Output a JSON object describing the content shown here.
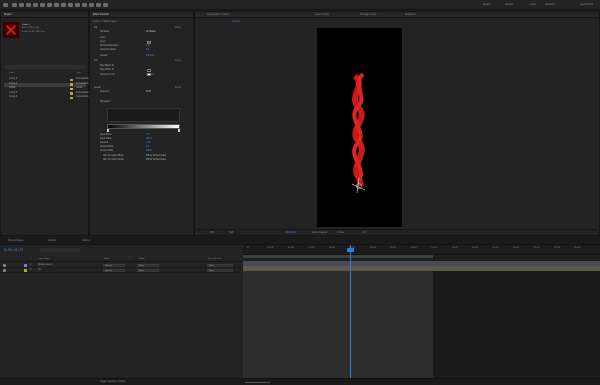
{
  "top_toolbar": {
    "workspaces": [
      "Default",
      "Review",
      "Learn",
      "Standard",
      "Small Screen",
      "Libraries"
    ],
    "search_help": "Search Help"
  },
  "project_panel": {
    "tab": "Project",
    "comp_name": "Comp 1",
    "info_line1": "800 x 1200 (1.00)",
    "info_line2": "Δ 0;00;10;00, 29.97 fps",
    "columns": [
      "Name",
      "Type"
    ],
    "items": [
      {
        "name": "Comp 1",
        "type": "Composition",
        "color": "#b5a14d"
      },
      {
        "name": "Comp 1",
        "type": "Composition",
        "color": "#b5a14d"
      },
      {
        "name": "Solids",
        "type": "Folder",
        "color": "#c9b24b"
      },
      {
        "name": "Comp 2",
        "type": "Composition",
        "color": "#b5a14d"
      },
      {
        "name": "Comp 3",
        "type": "Composition",
        "color": "#b5a14d"
      }
    ]
  },
  "effect_controls": {
    "tab": "Effect Controls",
    "subtitle": "Comp 1 • Shape Layer 1",
    "effects": [
      {
        "label": "Fill",
        "value": "Reset"
      },
      {
        "label": "Fill Mask",
        "value": "All Masks"
      },
      {
        "label": "Color",
        "value": ""
      },
      {
        "label": "Invert",
        "value": ""
      },
      {
        "label": "Horizontal Feather",
        "value": "0.0"
      },
      {
        "label": "Vertical Feather",
        "value": "0.0"
      },
      {
        "label": "Opacity",
        "value": "100.0%"
      },
      {
        "label": "Tint",
        "value": "Reset"
      },
      {
        "label": "Map Black To",
        "value": ""
      },
      {
        "label": "Map White To",
        "value": ""
      },
      {
        "label": "Amount to Tint",
        "value": "100.0%"
      },
      {
        "label": "Levels",
        "value": "Reset"
      },
      {
        "label": "Channel:",
        "value": "RGB"
      },
      {
        "label": "Histogram",
        "value": ""
      },
      {
        "label": "Input Black",
        "value": "0.0"
      },
      {
        "label": "Input White",
        "value": "255.0"
      },
      {
        "label": "Gamma",
        "value": "1.00"
      },
      {
        "label": "Output Black",
        "value": "0.0"
      },
      {
        "label": "Output White",
        "value": "255.0"
      },
      {
        "label": "Clip To Output Black",
        "value": "Off for 32 bpc Color"
      },
      {
        "label": "Clip To Output White",
        "value": "Off for 32 bpc Color"
      }
    ],
    "fill_color": "#d81e1e",
    "tint_black": "#000000",
    "tint_white": "#ffffff"
  },
  "composition_panel": {
    "tabs": [
      "Composition: Comp 1",
      "Layer (none)",
      "Footage (none)",
      "Flowchart"
    ],
    "breadcrumb": "Comp 1",
    "viewer_bar": {
      "zoom": "50%",
      "resolution": "Half",
      "timecode": "0;00;04;22",
      "camera": "Active Camera",
      "views": "1 View",
      "offset": "+0.0"
    }
  },
  "timeline": {
    "tabs": [
      "Render Queue",
      "Comp 1",
      "Comp 2"
    ],
    "timecode": "0;00;04;22",
    "columns": [
      "#",
      "Layer Name",
      "Mode",
      "T",
      "TrkMat",
      "Parent & Link"
    ],
    "layers": [
      {
        "num": "1",
        "name": "Shape Layer 1",
        "mode": "Normal",
        "trkmat": "None",
        "parent": "None",
        "label_color": "#7b7bd6"
      },
      {
        "num": "2",
        "name": "[1]",
        "mode": "Normal",
        "trkmat": "None",
        "parent": "None",
        "label_color": "#b5a14d"
      }
    ],
    "ruler_labels": [
      "0f",
      "00:15f",
      "01:00f",
      "01:15f",
      "02:00f",
      "02:15f",
      "03:00f",
      "03:15f",
      "04:00f",
      "04:15f",
      "05:00f",
      "05:15f",
      "06:00f",
      "06:15f",
      "07:00f",
      "07:15f",
      "08:00f"
    ],
    "bottom": "Toggle Switches / Modes"
  }
}
